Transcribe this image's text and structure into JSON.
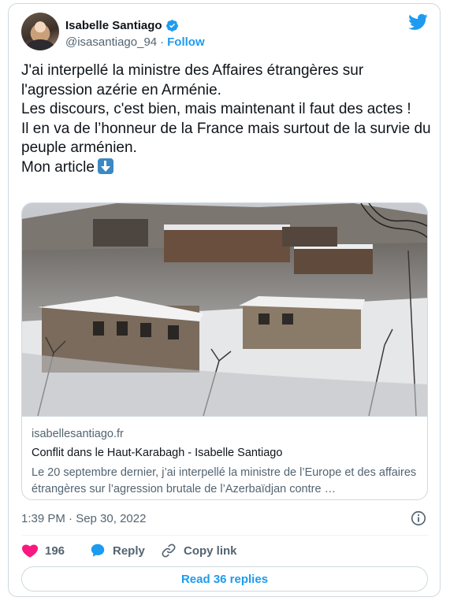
{
  "author": {
    "name": "Isabelle Santiago",
    "handle": "@isasantiago_94",
    "separator": "·",
    "follow_label": "Follow",
    "verified": true
  },
  "tweet": {
    "lines": [
      "J'ai interpellé la ministre des Affaires étrangères sur l'agression azérie en Arménie.",
      "Les discours, c'est bien, mais maintenant il faut des actes !",
      "Il en va de l’honneur de la France mais surtout de la survie du peuple arménien.",
      "Mon article"
    ],
    "emoji": "down-arrow-emoji"
  },
  "card": {
    "image_alt": "Snowy village with stone houses on a hillside",
    "domain": "isabellesantiago.fr",
    "title": "Conflit dans le Haut-Karabagh - Isabelle Santiago",
    "description": "Le 20 septembre dernier, j’ai interpellé la ministre de l’Europe et des affaires étrangères sur l’agression brutale de l’Azerbaïdjan contre …"
  },
  "timestamp": "1:39 PM · Sep 30, 2022",
  "actions": {
    "likes": "196",
    "reply_label": "Reply",
    "copy_link_label": "Copy link"
  },
  "read_replies_label": "Read 36 replies",
  "colors": {
    "accent": "#1d9bf0",
    "like": "#f91880",
    "text": "#0f1419",
    "muted": "#536471",
    "border": "#cfd9de"
  }
}
